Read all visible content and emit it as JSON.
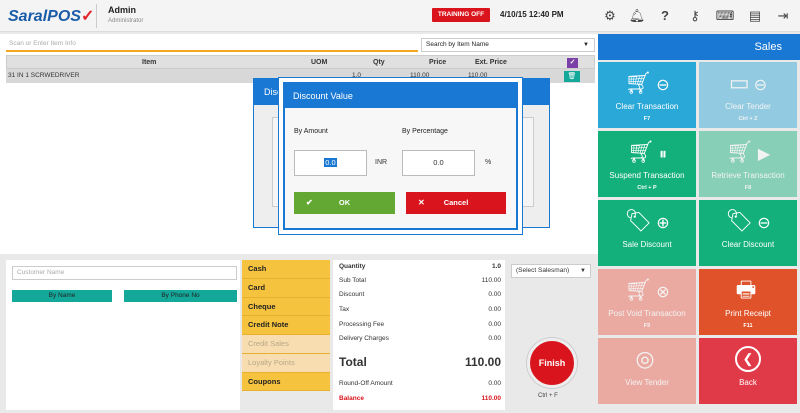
{
  "app": {
    "logo_main": "SaralPOS",
    "logo_mark": "✓"
  },
  "user": {
    "name": "Admin",
    "role": "Administrator"
  },
  "header": {
    "training_label": "TRAINING OFF",
    "datetime": "4/10/15 12:40 PM"
  },
  "search": {
    "placeholder": "Scan or Enter Item Info",
    "by_value": "Search by Item Name"
  },
  "table": {
    "columns": [
      "Item",
      "UOM",
      "Qty",
      "Price",
      "Ext. Price"
    ],
    "rows": [
      {
        "item": "31 IN 1 SCRWEDRIVER",
        "qty": "1.0",
        "price": "110.00",
        "ext": "110.00"
      }
    ]
  },
  "customer": {
    "placeholder": "Customer Name",
    "by_name": "By Name",
    "by_phone": "By Phone No"
  },
  "payments": [
    "Cash",
    "Card",
    "Cheque",
    "Credit Note",
    "Credit Sales",
    "Loyalty Points",
    "Coupons"
  ],
  "summary": {
    "quantity_label": "Quantity",
    "quantity": "1.0",
    "subtotal_label": "Sub Total",
    "subtotal": "110.00",
    "discount_label": "Discount",
    "discount": "0.00",
    "tax_label": "Tax",
    "tax": "0.00",
    "processing_label": "Processing Fee",
    "processing": "0.00",
    "delivery_label": "Delivery Charges",
    "delivery": "0.00",
    "total_label": "Total",
    "total": "110.00",
    "roundoff_label": "Round-Off Amount",
    "roundoff": "0.00",
    "balance_label": "Balance",
    "balance": "110.00"
  },
  "salesman": {
    "value": "(Select Salesman)"
  },
  "finish": {
    "label": "Finish",
    "key": "Ctrl + F"
  },
  "sales_panel": {
    "title": "Sales",
    "tiles": [
      {
        "label": "Clear Transaction",
        "key": "F7",
        "color": "#2aa8d8",
        "icon": "cart-minus-icon"
      },
      {
        "label": "Clear Tender",
        "key": "Ctrl + Z",
        "color": "#2aa8d8",
        "icon": "card-minus-icon"
      },
      {
        "label": "Suspend Transaction",
        "key": "Ctrl + P",
        "color": "#13b07c",
        "icon": "cart-pause-icon"
      },
      {
        "label": "Retrieve Transaction",
        "key": "F8",
        "color": "#13b07c",
        "icon": "cart-play-icon"
      },
      {
        "label": "Sale Discount",
        "key": "",
        "color": "#13b07c",
        "icon": "tag-plus-icon"
      },
      {
        "label": "Clear Discount",
        "key": "",
        "color": "#13b07c",
        "icon": "tag-minus-icon"
      },
      {
        "label": "Post Void Transaction",
        "key": "F9",
        "color": "#ef5e4c",
        "icon": "cart-x-icon"
      },
      {
        "label": "Print Receipt",
        "key": "F11",
        "color": "#e0532a",
        "icon": "printer-icon"
      },
      {
        "label": "View Tender",
        "key": "",
        "color": "#ef5e4c",
        "icon": "coins-icon"
      },
      {
        "label": "Back",
        "key": "",
        "color": "#e03a48",
        "icon": "back-icon"
      }
    ]
  },
  "dialog_back": {
    "title_partial": "Disc"
  },
  "dialog": {
    "title": "Discount Value",
    "by_amount_label": "By Amount",
    "by_percentage_label": "By Percentage",
    "amount_value": "0.0",
    "amount_unit": "INR",
    "percentage_value": "0.0",
    "percentage_unit": "%",
    "ok_label": "OK",
    "cancel_label": "Cancel"
  }
}
